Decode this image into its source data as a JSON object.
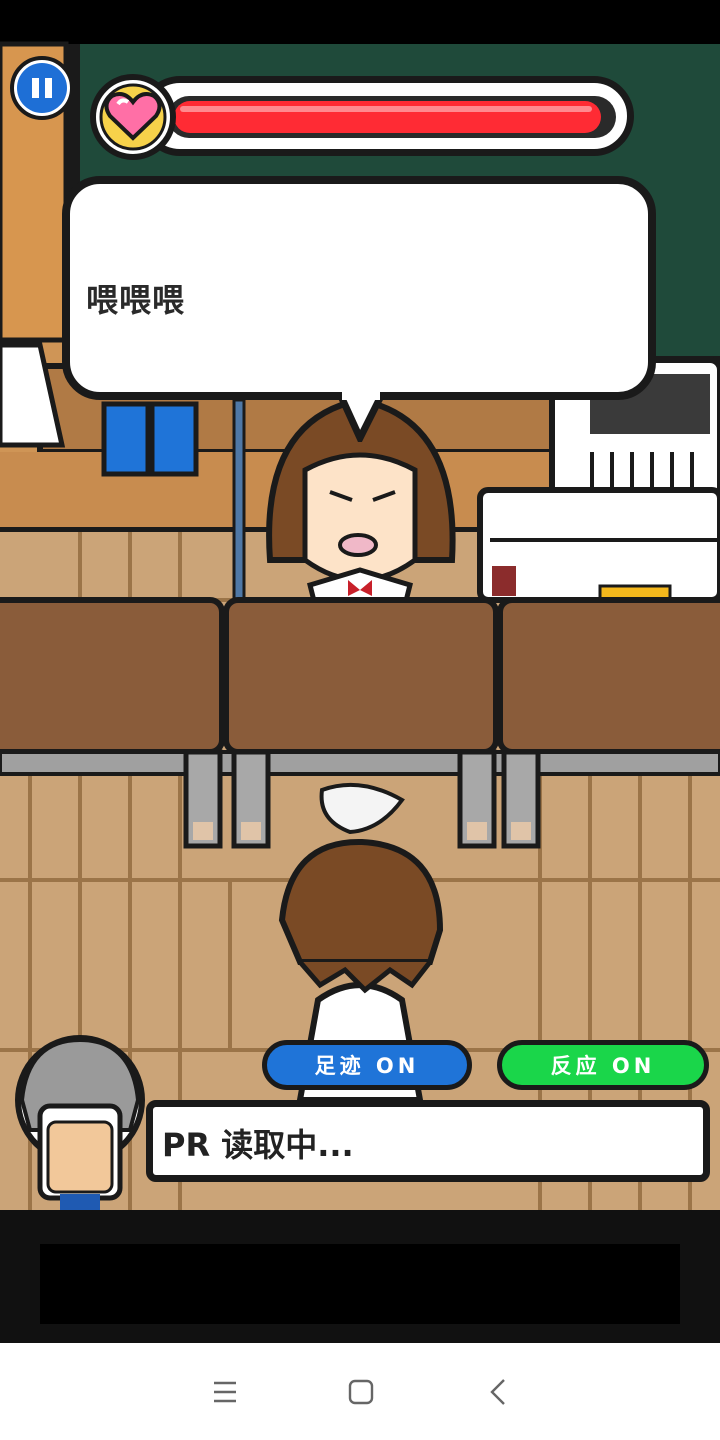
{
  "game": {
    "speech_text": "喂喂喂",
    "hp_fraction": 0.98,
    "status_text": "PR 读取中...",
    "footprint_toggle": "足迹 ON",
    "reaction_toggle": "反应 ON"
  },
  "colors": {
    "hp_fill": "#ff2b34",
    "footprint_toggle": "#1f74d8",
    "reaction_toggle": "#1ad64a",
    "blackboard": "#1f4a3a",
    "floor": "#cba478"
  },
  "icons": {
    "pause": "pause-icon",
    "heart": "heart-icon",
    "nav_menu": "menu-icon",
    "nav_home": "square-home-icon",
    "nav_back": "chevron-left-icon"
  }
}
